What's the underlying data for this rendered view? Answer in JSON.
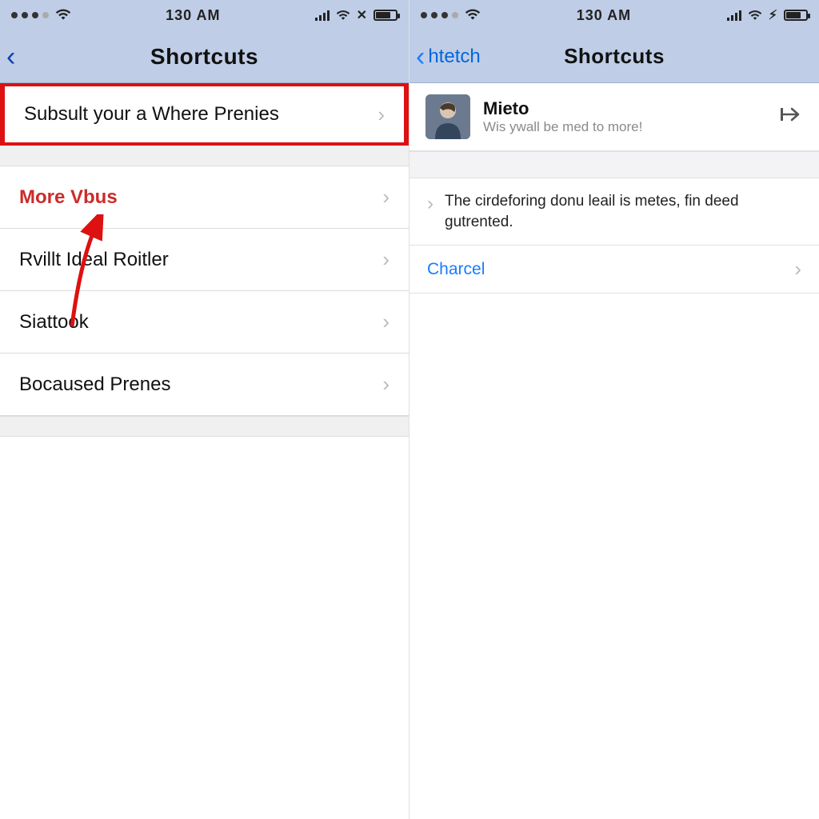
{
  "left": {
    "status": {
      "time": "130 AM"
    },
    "nav": {
      "title": "Shortcuts"
    },
    "rows": {
      "highlighted": "Subsult your a Where Prenies",
      "items": [
        "More Vbus",
        "Rvillt Ideal Roitler",
        "Siattook",
        "Bocaused Prenes"
      ]
    }
  },
  "right": {
    "status": {
      "time": "130 AM"
    },
    "nav": {
      "back_label": "htetch",
      "title": "Shortcuts"
    },
    "profile": {
      "name": "Mieto",
      "subtitle": "Wis ywall be med to more!"
    },
    "description": "The cirdeforing donu leail is metes, fin deed gutrented.",
    "link": "Charcel"
  }
}
